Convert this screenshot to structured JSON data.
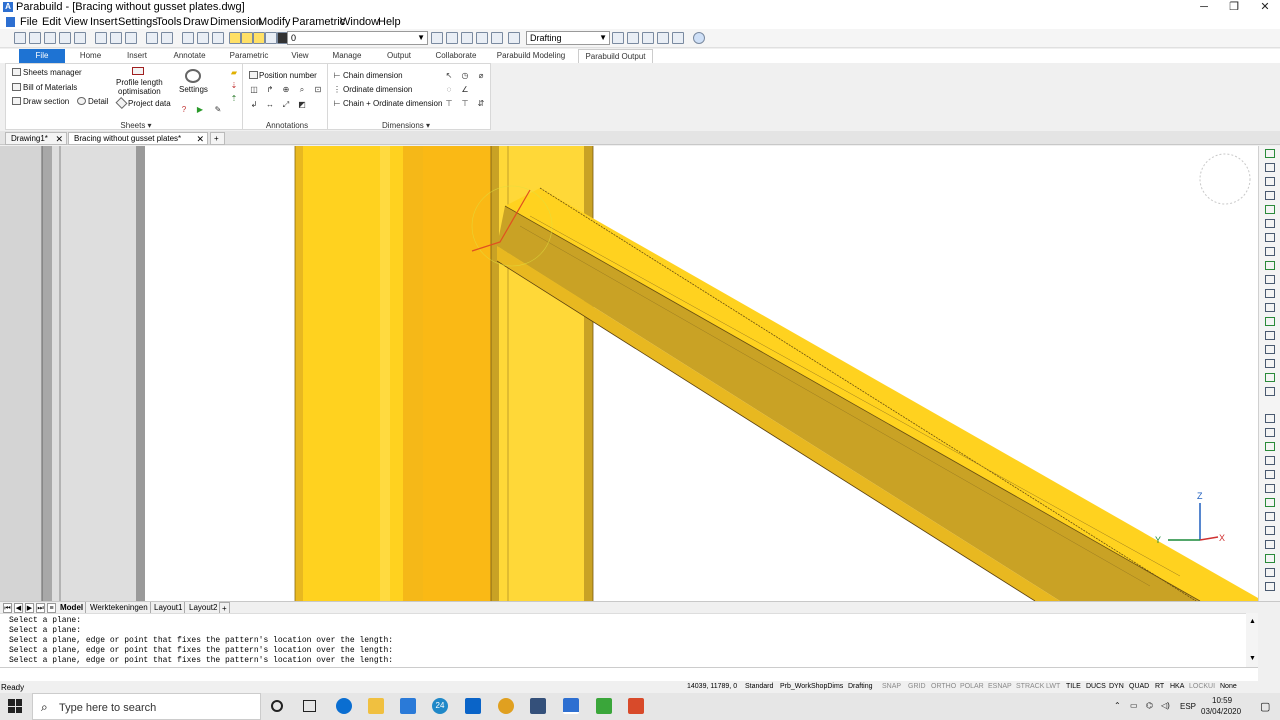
{
  "window": {
    "title": "Parabuild - [Bracing without gusset plates.dwg]",
    "app_icon_letter": "A"
  },
  "menu": [
    "File",
    "Edit",
    "View",
    "Insert",
    "Settings",
    "Tools",
    "Draw",
    "Dimension",
    "Modify",
    "Parametric",
    "Window",
    "Help"
  ],
  "toolbar": {
    "layer_value": "0",
    "workspace_value": "Drafting"
  },
  "ribbon_tabs": [
    "File",
    "Home",
    "Insert",
    "Annotate",
    "Parametric",
    "View",
    "Manage",
    "Output",
    "Collaborate",
    "Parabuild Modeling",
    "Parabuild Output"
  ],
  "ribbon": {
    "sheets": {
      "sheets_manager": "Sheets manager",
      "bill_of_materials": "Bill of Materials",
      "draw_section": "Draw section",
      "detail": "Detail",
      "profile_length": "Profile length",
      "optimisation": "optimisation",
      "project_data": "Project data",
      "settings": "Settings",
      "group_label": "Sheets"
    },
    "annotations": {
      "position_number": "Position number",
      "group_label": "Annotations"
    },
    "dimensions": {
      "chain": "Chain dimension",
      "ordinate": "Ordinate dimension",
      "chain_ordinate": "Chain + Ordinate dimension",
      "group_label": "Dimensions"
    }
  },
  "doc_tabs": [
    {
      "label": "Drawing1*",
      "active": false
    },
    {
      "label": "Bracing without gusset plates*",
      "active": true
    }
  ],
  "add_tab_label": "+",
  "ucs_icon": {
    "z": "Z",
    "y": "Y",
    "x": "X"
  },
  "layout_tabs": [
    "Model",
    "Werktekeningen",
    "Layout1",
    "Layout2"
  ],
  "command_history": [
    "Select a plane:",
    "Select a plane:",
    "Select a plane, edge or point that fixes the pattern's location over the length:",
    "Select a plane, edge or point that fixes the pattern's location over the length:",
    "Select a plane, edge or point that fixes the pattern's location over the length:"
  ],
  "status": {
    "ready": "Ready",
    "coords": "14039, 11789, 0",
    "items": [
      {
        "label": "Standard",
        "on": true
      },
      {
        "label": "Prb_WorkShopDims",
        "on": true
      },
      {
        "label": "Drafting",
        "on": true
      },
      {
        "label": "SNAP",
        "on": false
      },
      {
        "label": "GRID",
        "on": false
      },
      {
        "label": "ORTHO",
        "on": false
      },
      {
        "label": "POLAR",
        "on": false
      },
      {
        "label": "ESNAP",
        "on": false
      },
      {
        "label": "STRACK",
        "on": false
      },
      {
        "label": "LWT",
        "on": false
      },
      {
        "label": "TILE",
        "on": true
      },
      {
        "label": "DUCS",
        "on": true
      },
      {
        "label": "DYN",
        "on": true
      },
      {
        "label": "QUAD",
        "on": true
      },
      {
        "label": "RT",
        "on": true
      },
      {
        "label": "HKA",
        "on": true
      },
      {
        "label": "LOCKUI",
        "on": false
      },
      {
        "label": "None",
        "on": true
      }
    ]
  },
  "taskbar": {
    "search_placeholder": "Type here to search",
    "language": "ESP",
    "time": "10:59",
    "date": "03/04/2020",
    "badge": "24"
  },
  "colors": {
    "steel_yellow": "#ffd21f",
    "steel_dark": "#c9a225",
    "file_tab": "#1e73d3",
    "accent_blue": "#2d6fd1"
  }
}
